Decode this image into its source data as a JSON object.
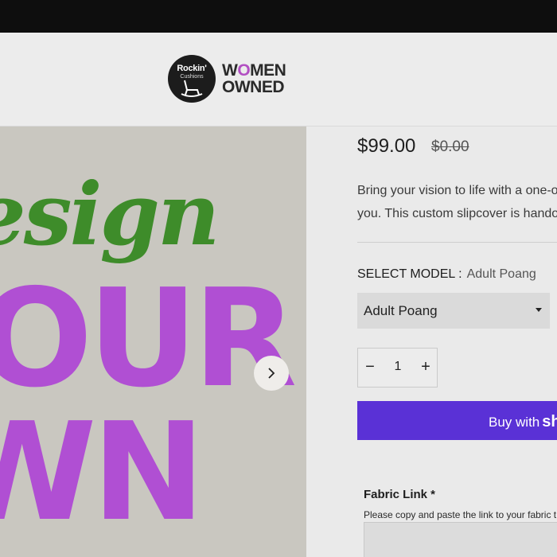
{
  "brand": {
    "badge_line1": "Rockin'",
    "badge_line2": "Cushions",
    "women_owned_line1_pre": "W",
    "women_owned_line1_o": "O",
    "women_owned_line1_post": "MEN",
    "women_owned_line2": "OWNED"
  },
  "hero": {
    "script_text": "esign",
    "big_line1": "OUR",
    "big_line2": "WN",
    "next_arrow_icon": "chevron-right-icon"
  },
  "product": {
    "price": "$99.00",
    "compare_price": "$0.00",
    "description_line1": "Bring your vision to life with a one-o",
    "description_line2": "you. This custom slipcover is hando",
    "select_model_label": "SELECT MODEL :",
    "select_model_value": "Adult Poang",
    "dropdown_selected": "Adult Poang",
    "quantity": "1",
    "minus_symbol": "−",
    "plus_symbol": "+",
    "buy_label": "Buy with",
    "buy_brand": "sh"
  },
  "fabric": {
    "title": "Fabric Link *",
    "help": "Please copy and paste the link to your fabric t",
    "input_value": ""
  },
  "colors": {
    "hero_bg": "#c9c7c0",
    "script_green": "#3e8c2a",
    "headline_purple": "#b04fd3",
    "buy_button": "#5a31d6"
  }
}
